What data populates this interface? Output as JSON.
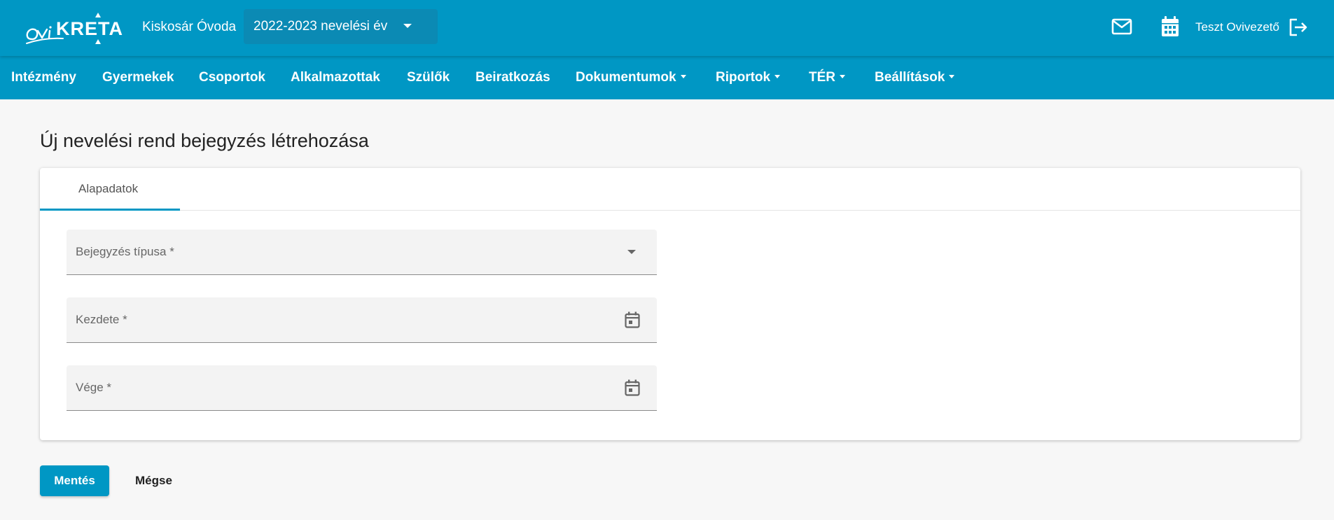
{
  "header": {
    "logo_text": "oviKRÉTA",
    "institution": "Kiskosár Óvoda",
    "school_year": "2022-2023 nevelési év",
    "user_name": "Teszt Ovivezető",
    "icons": [
      "mail-icon",
      "calendar-icon",
      "logout-icon"
    ]
  },
  "nav": {
    "items": [
      {
        "label": "Intézmény",
        "dropdown": false
      },
      {
        "label": "Gyermekek",
        "dropdown": false
      },
      {
        "label": "Csoportok",
        "dropdown": false
      },
      {
        "label": "Alkalmazottak",
        "dropdown": false
      },
      {
        "label": "Szülők",
        "dropdown": false
      },
      {
        "label": "Beiratkozás",
        "dropdown": false
      },
      {
        "label": "Dokumentumok",
        "dropdown": true
      },
      {
        "label": "Riportok",
        "dropdown": true
      },
      {
        "label": "TÉR",
        "dropdown": true
      },
      {
        "label": "Beállítások",
        "dropdown": true
      }
    ]
  },
  "page": {
    "title": "Új nevelési rend bejegyzés létrehozása"
  },
  "card": {
    "tabs": [
      {
        "label": "Alapadatok",
        "active": true
      }
    ],
    "fields": [
      {
        "label": "Bejegyzés típusa *",
        "type": "select",
        "value": ""
      },
      {
        "label": "Kezdete *",
        "type": "date",
        "value": ""
      },
      {
        "label": "Vége *",
        "type": "date",
        "value": ""
      }
    ]
  },
  "actions": {
    "save_label": "Mentés",
    "cancel_label": "Mégse"
  },
  "colors": {
    "brand": "#0097c4",
    "background": "#f7f7f7",
    "field_background": "#f3f3f3"
  }
}
